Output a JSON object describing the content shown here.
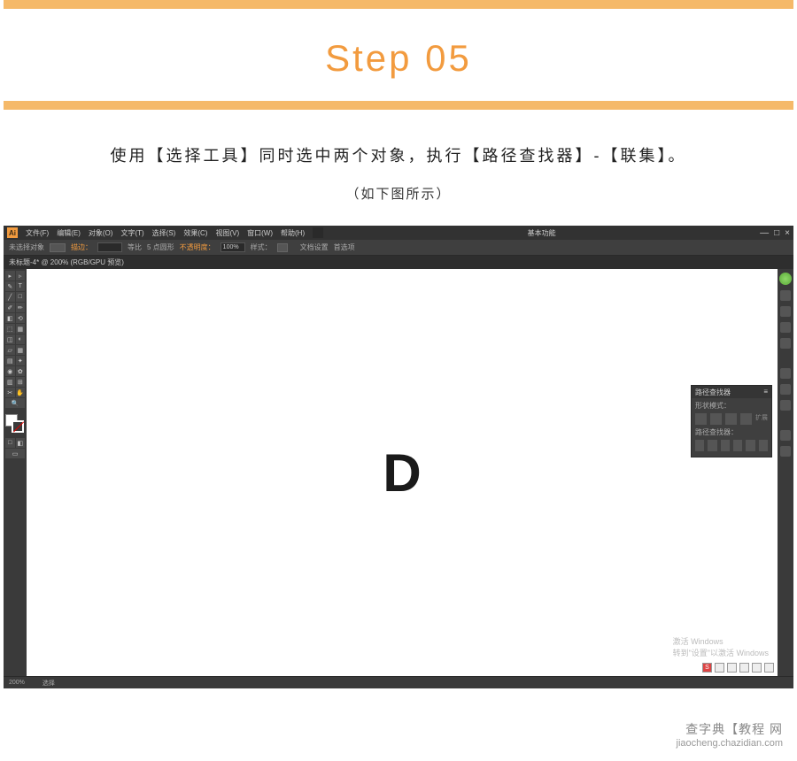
{
  "step": {
    "title": "Step 05"
  },
  "instruction": {
    "main": "使用【选择工具】同时选中两个对象，执行【路径查找器】-【联集】。",
    "sub": "（如下图所示）"
  },
  "illustrator": {
    "logo": "Ai",
    "menubar": [
      "文件(F)",
      "编辑(E)",
      "对象(O)",
      "文字(T)",
      "选择(S)",
      "效果(C)",
      "视图(V)",
      "窗口(W)",
      "帮助(H)"
    ],
    "workspace_label": "基本功能",
    "window_controls": [
      "—",
      "□",
      "×"
    ],
    "options": {
      "no_selection": "未选择对象",
      "stroke_label": "描边：",
      "stroke_value": "",
      "uniform_label": "等比",
      "points_label": "5 点圆形",
      "opacity_label": "不透明度：",
      "opacity_value": "100%",
      "style_label": "样式：",
      "doc_setup": "文档设置",
      "preferences": "首选项"
    },
    "tab": "未标题-4* @ 200% (RGB/GPU 预览)",
    "canvas_content": "D",
    "watermark_line1": "激活 Windows",
    "watermark_line2": "转到\"设置\"以激活 Windows",
    "pathfinder": {
      "title": "路径查找器",
      "shape_modes_label": "形状模式：",
      "expand_label": "扩展",
      "pathfinders_label": "路径查找器："
    },
    "status": {
      "zoom": "200%",
      "tool_hint": "选择"
    }
  },
  "footer": {
    "main": "查字典【教程 网",
    "sub": "jiaocheng.chazidian.com"
  },
  "tools": [
    "▸",
    "▹",
    "✎",
    "T",
    "／",
    "□",
    "✂",
    "◉",
    "⟲",
    "⬚",
    "▦",
    "◐",
    "✦",
    "℅",
    "⊞",
    "↔",
    "✋",
    "🔍"
  ],
  "systray_text": "S"
}
